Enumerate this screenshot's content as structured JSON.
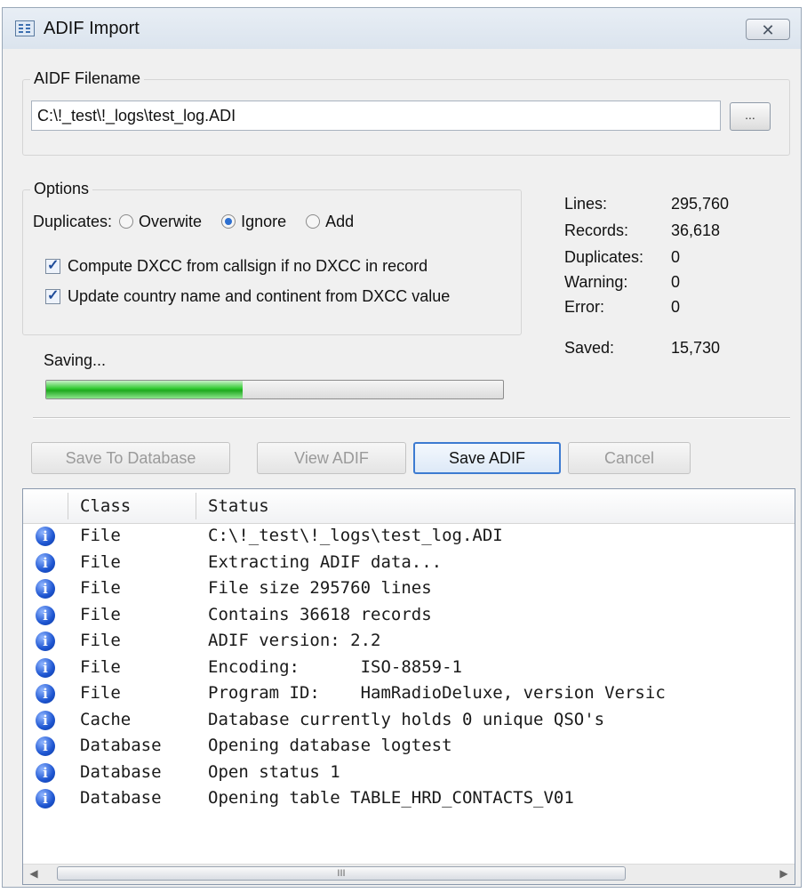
{
  "window": {
    "title": "ADIF Import",
    "close_glyph": "✕"
  },
  "filename_group": {
    "legend": "AIDF Filename",
    "value": "C:\\!_test\\!_logs\\test_log.ADI",
    "browse_label": "..."
  },
  "options": {
    "legend": "Options",
    "duplicates_label": "Duplicates:",
    "radios": [
      {
        "label": "Overwite",
        "checked": false
      },
      {
        "label": "Ignore",
        "checked": true
      },
      {
        "label": "Add",
        "checked": false
      }
    ],
    "checkboxes": [
      {
        "label": "Compute DXCC from callsign if no DXCC in record",
        "checked": true
      },
      {
        "label": "Update country name and continent from DXCC value",
        "checked": true
      }
    ]
  },
  "stats": [
    {
      "label": "Lines:",
      "value": "295,760"
    },
    {
      "label": "Records:",
      "value": "36,618"
    },
    {
      "label": "Duplicates:",
      "value": "0"
    },
    {
      "label": "Warning:",
      "value": "0"
    },
    {
      "label": "Error:",
      "value": "0"
    },
    {
      "label": "Saved:",
      "value": "15,730"
    }
  ],
  "progress": {
    "label": "Saving...",
    "fraction": 0.43,
    "color": "#2fc92f"
  },
  "buttons": {
    "save_to_db": "Save To Database",
    "view_adif": "View ADIF",
    "save_adif": "Save ADIF",
    "cancel": "Cancel"
  },
  "log": {
    "columns": [
      "Class",
      "Status"
    ],
    "rows": [
      {
        "icon": "info-icon",
        "class": "File",
        "status": "C:\\!_test\\!_logs\\test_log.ADI"
      },
      {
        "icon": "info-icon",
        "class": "File",
        "status": "Extracting ADIF data..."
      },
      {
        "icon": "info-icon",
        "class": "File",
        "status": "File size 295760 lines"
      },
      {
        "icon": "info-icon",
        "class": "File",
        "status": "Contains 36618 records"
      },
      {
        "icon": "info-icon",
        "class": "File",
        "status": "ADIF version: 2.2"
      },
      {
        "icon": "info-icon",
        "class": "File",
        "status": "Encoding:      ISO-8859-1"
      },
      {
        "icon": "info-icon",
        "class": "File",
        "status": "Program ID:    HamRadioDeluxe, version Versic"
      },
      {
        "icon": "info-icon",
        "class": "Cache",
        "status": "Database currently holds 0 unique QSO's"
      },
      {
        "icon": "info-icon",
        "class": "Database",
        "status": "Opening database logtest"
      },
      {
        "icon": "info-icon",
        "class": "Database",
        "status": "Open status 1"
      },
      {
        "icon": "info-icon",
        "class": "Database",
        "status": "Opening table TABLE_HRD_CONTACTS_V01"
      }
    ],
    "scroll_grip": "III"
  }
}
